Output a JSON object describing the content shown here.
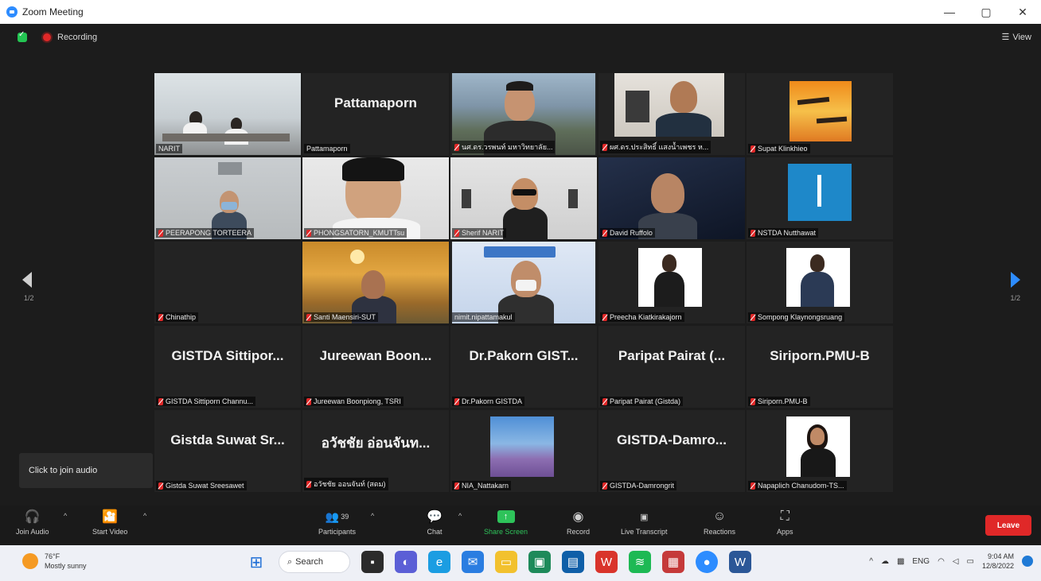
{
  "window": {
    "title": "Zoom Meeting",
    "controls": [
      "minimize",
      "maximize",
      "close"
    ]
  },
  "topbar": {
    "recording_label": "Recording",
    "view_label": "View"
  },
  "navigation": {
    "page_left": "1/2",
    "page_right": "1/2"
  },
  "tiles": [
    {
      "label": "NARIT",
      "big_name": "",
      "muted": false,
      "active": true
    },
    {
      "label": "Pattamaporn",
      "big_name": "Pattamaporn",
      "muted": false,
      "active": false
    },
    {
      "label": "นศ.ดร.วรพนท์ มหาวิทยาลัย...",
      "big_name": "",
      "muted": true,
      "active": false
    },
    {
      "label": "ผศ.ดร.ประสิทธิ์ แสงน้ำเพชร ห...",
      "big_name": "",
      "muted": true,
      "active": false
    },
    {
      "label": "Supat Klinkhieo",
      "big_name": "",
      "muted": true,
      "active": false
    },
    {
      "label": "PEERAPONG TORTEERA",
      "big_name": "",
      "muted": true,
      "active": false
    },
    {
      "label": "PHONGSATORN_KMUTTsu",
      "big_name": "",
      "muted": true,
      "active": false
    },
    {
      "label": "Sherif NARIT",
      "big_name": "",
      "muted": true,
      "active": false
    },
    {
      "label": "David Ruffolo",
      "big_name": "",
      "muted": true,
      "active": false
    },
    {
      "label": "NSTDA Nutthawat",
      "big_name": "",
      "muted": true,
      "active": false
    },
    {
      "label": "Chinathip",
      "big_name": "",
      "muted": true,
      "active": false
    },
    {
      "label": "Santi Maensiri-SUT",
      "big_name": "",
      "muted": true,
      "active": false
    },
    {
      "label": "nimit.nipattamakul",
      "big_name": "",
      "muted": false,
      "active": false
    },
    {
      "label": "Preecha Kiatkirakajorn",
      "big_name": "",
      "muted": true,
      "active": false
    },
    {
      "label": "Sompong Klaynongsruang",
      "big_name": "",
      "muted": true,
      "active": false
    },
    {
      "label": "GISTDA Sittiporn Channu...",
      "big_name": "GISTDA Sittipor...",
      "muted": true,
      "active": false
    },
    {
      "label": "Jureewan Boonpiong, TSRI",
      "big_name": "Jureewan Boon...",
      "muted": true,
      "active": false
    },
    {
      "label": "Dr.Pakorn GISTDA",
      "big_name": "Dr.Pakorn GIST...",
      "muted": true,
      "active": false
    },
    {
      "label": "Paripat Pairat (Gistda)",
      "big_name": "Paripat Pairat (...",
      "muted": true,
      "active": false
    },
    {
      "label": "Siriporn.PMU-B",
      "big_name": "Siriporn.PMU-B",
      "muted": true,
      "active": false
    },
    {
      "label": "Gistda Suwat Sreesawet",
      "big_name": "Gistda Suwat Sr...",
      "muted": true,
      "active": false
    },
    {
      "label": "อวัชชัย ออนจันท์ (สดม)",
      "big_name": "อวัชชัย อ่อนจันท...",
      "muted": true,
      "active": false
    },
    {
      "label": "NIA_Nattakarn",
      "big_name": "",
      "muted": true,
      "active": false
    },
    {
      "label": "GISTDA-Damrongrit",
      "big_name": "GISTDA-Damro...",
      "muted": true,
      "active": false
    },
    {
      "label": "Napaplich Chanudom-TS...",
      "big_name": "",
      "muted": true,
      "active": false
    }
  ],
  "audio_tooltip": "Click to join audio",
  "toolbar": {
    "join_audio": "Join Audio",
    "start_video": "Start Video",
    "participants": "Participants",
    "participants_count": "39",
    "chat": "Chat",
    "share_screen": "Share Screen",
    "record": "Record",
    "live_transcript": "Live Transcript",
    "reactions": "Reactions",
    "apps": "Apps",
    "leave": "Leave"
  },
  "taskbar": {
    "weather_temp": "76°F",
    "weather_desc": "Mostly sunny",
    "search_label": "Search",
    "lang": "ENG",
    "time": "9:04 AM",
    "date": "12/8/2022"
  },
  "colors": {
    "accent": "#2d8cff",
    "leave": "#e02828",
    "share": "#2ec35a",
    "active_border": "#c6d94a"
  }
}
